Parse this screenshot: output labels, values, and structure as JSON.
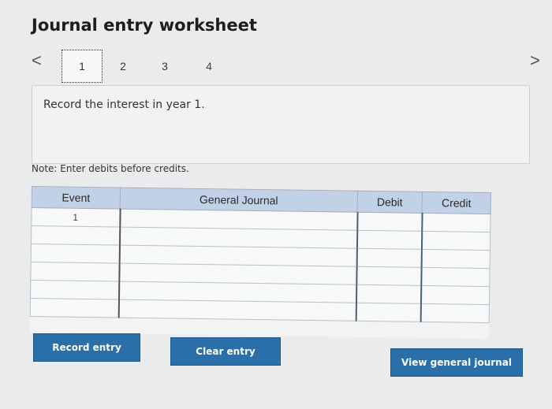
{
  "header": {
    "title": "Journal entry worksheet"
  },
  "nav": {
    "prev": "<",
    "next": ">"
  },
  "tabs": [
    {
      "label": "1"
    },
    {
      "label": "2"
    },
    {
      "label": "3"
    },
    {
      "label": "4"
    }
  ],
  "prompt": {
    "text": "Record the interest in year 1."
  },
  "note": {
    "text": "Note: Enter debits before credits."
  },
  "journal": {
    "columns": {
      "event": "Event",
      "general_journal": "General Journal",
      "debit": "Debit",
      "credit": "Credit"
    },
    "rows": [
      {
        "event": "1"
      },
      {
        "event": ""
      },
      {
        "event": ""
      },
      {
        "event": ""
      },
      {
        "event": ""
      },
      {
        "event": ""
      }
    ]
  },
  "buttons": {
    "record": "Record entry",
    "clear": "Clear entry",
    "view": "View general journal"
  },
  "colors": {
    "button": "#2a6fa8",
    "header": "#c2d2e6"
  }
}
